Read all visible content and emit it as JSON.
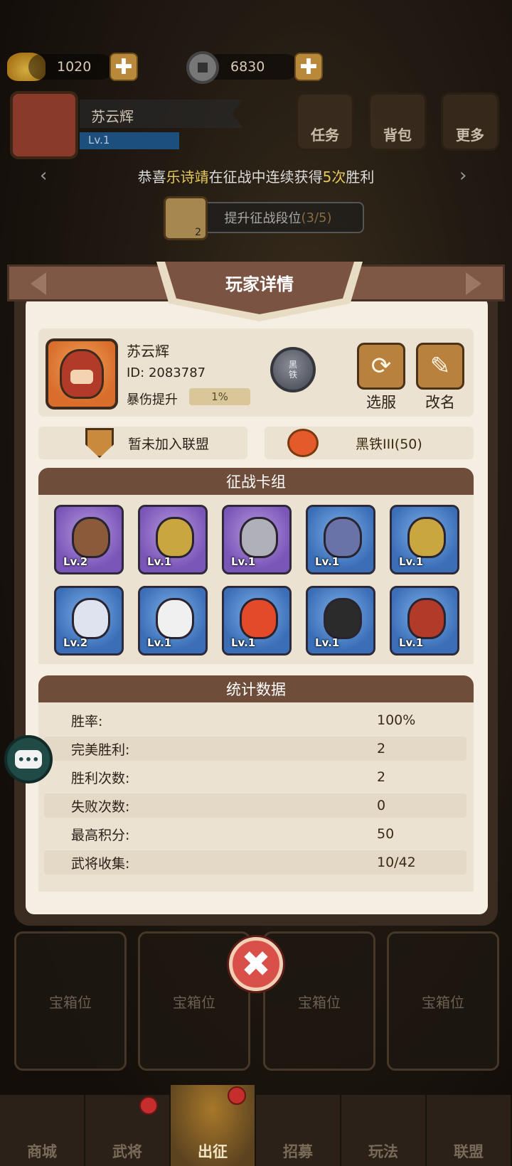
{
  "topbar": {
    "gold": "1020",
    "coins": "6830",
    "plus_symbol": "✚"
  },
  "player_top": {
    "name": "苏云辉",
    "level": "Lv.1"
  },
  "top_buttons": [
    "任务",
    "背包",
    "更多"
  ],
  "ticker": {
    "prefix": "恭喜",
    "player": "乐诗靖",
    "middle": "在征战中连续获得",
    "count": "5次",
    "suffix": "胜利"
  },
  "rank_button": {
    "label": "提升征战段位",
    "progress": "(3/5)",
    "badge": "2"
  },
  "modal": {
    "title": "玩家详情",
    "player": {
      "name": "苏云辉",
      "id": "ID: 2083787",
      "crit_label": "暴伤提升",
      "crit_value": "1%",
      "rank_badge_top": "黑",
      "rank_badge_bottom": "铁"
    },
    "buttons": {
      "select_server": "选服",
      "rename": "改名"
    },
    "alliance": "暂未加入联盟",
    "rank": "黑铁III(50)",
    "deck_title": "征战卡组",
    "deck": [
      {
        "level": "Lv.2",
        "frame": "purple",
        "color": "#8a5a3a"
      },
      {
        "level": "Lv.1",
        "frame": "purple",
        "color": "#c9a640"
      },
      {
        "level": "Lv.1",
        "frame": "purple",
        "color": "#b0b0b8"
      },
      {
        "level": "Lv.1",
        "frame": "blue",
        "color": "#6a73a8"
      },
      {
        "level": "Lv.1",
        "frame": "blue",
        "color": "#c9a640"
      },
      {
        "level": "Lv.2",
        "frame": "blue",
        "color": "#dfe3f0"
      },
      {
        "level": "Lv.1",
        "frame": "blue",
        "color": "#f0f0f0"
      },
      {
        "level": "Lv.1",
        "frame": "blue",
        "color": "#e24a2a"
      },
      {
        "level": "Lv.1",
        "frame": "blue",
        "color": "#2b2b2b"
      },
      {
        "level": "Lv.1",
        "frame": "blue",
        "color": "#b23a28"
      }
    ],
    "stats_title": "统计数据",
    "stats": [
      {
        "label": "胜率:",
        "value": "100%"
      },
      {
        "label": "完美胜利:",
        "value": "2"
      },
      {
        "label": "胜利次数:",
        "value": "2"
      },
      {
        "label": "失败次数:",
        "value": "0"
      },
      {
        "label": "最高积分:",
        "value": "50"
      },
      {
        "label": "武将收集:",
        "value": "10/42"
      }
    ],
    "close_symbol": "✖"
  },
  "chat_symbol": "•••",
  "chests": [
    "宝箱位",
    "宝箱位",
    "宝箱位",
    "宝箱位"
  ],
  "nav": [
    "商城",
    "武将",
    "出征",
    "招募",
    "玩法",
    "联盟"
  ]
}
